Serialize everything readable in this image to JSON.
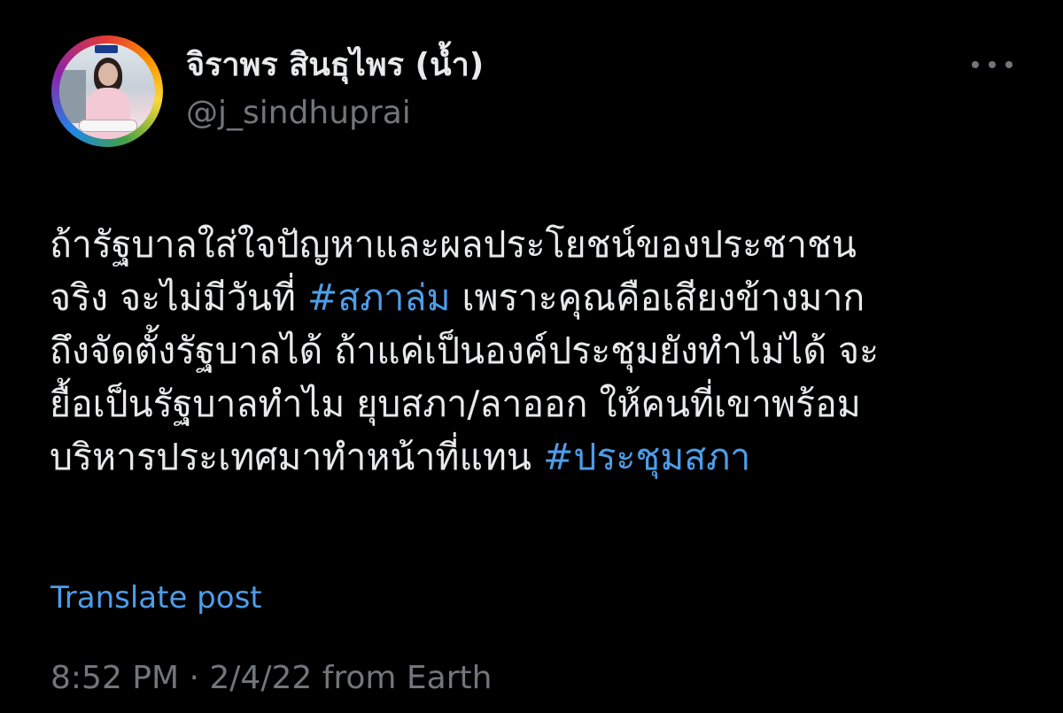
{
  "author": {
    "display_name": "จิราพร สินธุไพร (น้ำ)",
    "handle": "@j_sindhuprai",
    "avatar_ring_style": "rainbow"
  },
  "post": {
    "lines": [
      [
        {
          "text": "ถ้ารัฐบาลใส่ใจปัญหาและผลประโยชน์ของประชาชน"
        }
      ],
      [
        {
          "text": "จริง จะไม่มีวันที่ "
        },
        {
          "text": "#สภาล่ม",
          "hashtag": true
        },
        {
          "text": " เพราะคุณคือเสียงข้างมาก"
        }
      ],
      [
        {
          "text": "ถึงจัดตั้งรัฐบาลได้ ถ้าแค่เป็นองค์ประชุมยังทำไม่ได้ จะ"
        }
      ],
      [
        {
          "text": "ยื้อเป็นรัฐบาลทำไม ยุบสภา/ลาออก ให้คนที่เขาพร้อม"
        }
      ],
      [
        {
          "text": "บริหารประเทศมาทำหน้าที่แทน "
        },
        {
          "text": "#ประชุมสภา",
          "hashtag": true
        }
      ]
    ],
    "translate_label": "Translate post",
    "meta": "8:52 PM · 2/4/22 from Earth"
  },
  "icons": {
    "more": "more-horizontal-icon"
  },
  "colors": {
    "background": "#000000",
    "primary_text": "#e7e9ea",
    "secondary_text": "#71767b",
    "link": "#4d9de9"
  }
}
